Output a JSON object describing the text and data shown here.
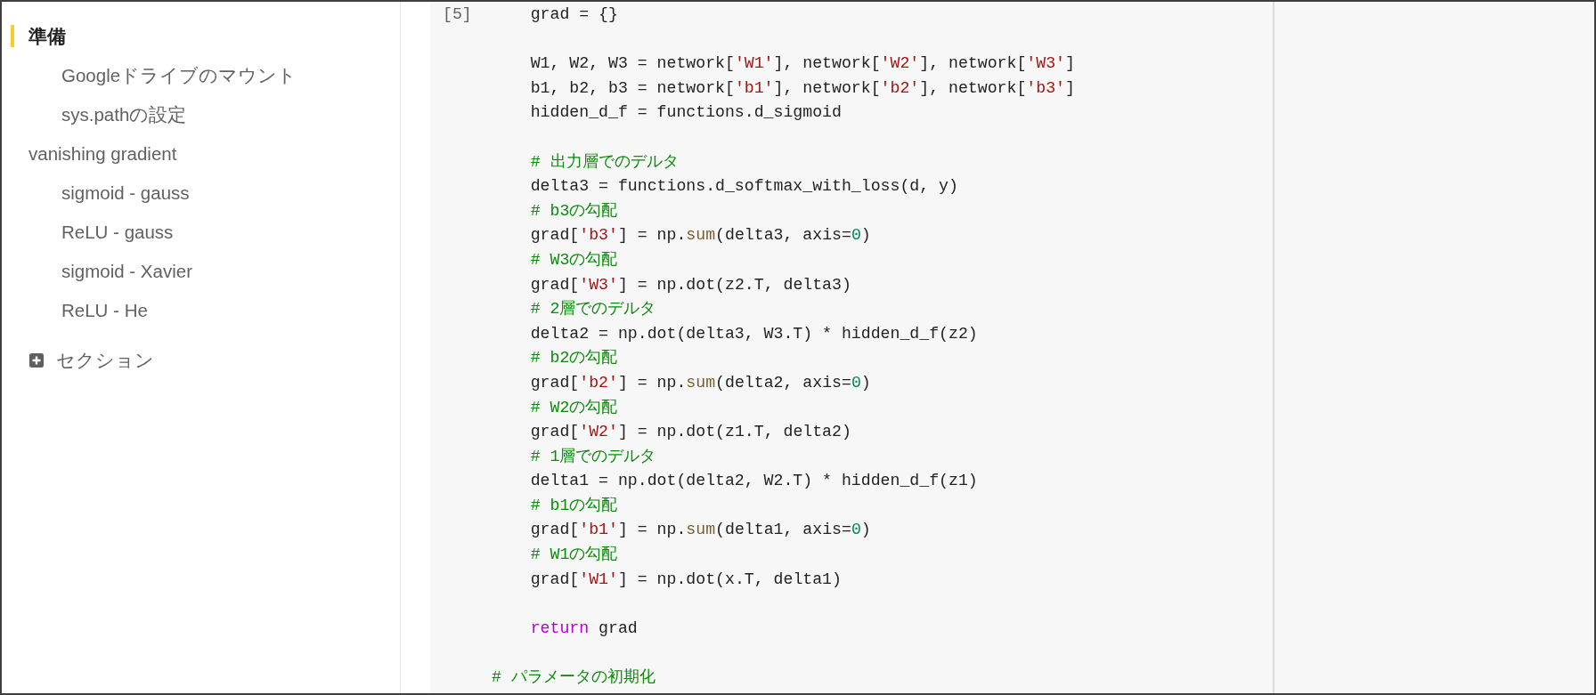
{
  "sidebar": {
    "items": [
      {
        "label": "準備",
        "selected": true,
        "children": [
          {
            "label": "Googleドライブのマウント",
            "selected": false
          },
          {
            "label": "sys.pathの設定",
            "selected": false
          }
        ]
      },
      {
        "label": "vanishing gradient",
        "selected": false,
        "children": [
          {
            "label": "sigmoid - gauss",
            "selected": false
          },
          {
            "label": "ReLU - gauss",
            "selected": false
          },
          {
            "label": "sigmoid - Xavier",
            "selected": false
          },
          {
            "label": "ReLU - He",
            "selected": false
          }
        ]
      }
    ],
    "add_section": {
      "label": "セクション"
    }
  },
  "code_cell": {
    "execution_count": "[5]",
    "blocks": [
      [
        [
          {
            "kind": "plain",
            "text": "    grad = {}"
          }
        ]
      ],
      [
        [
          {
            "kind": "plain",
            "text": "    W1, W2, W3 = network["
          },
          {
            "kind": "string",
            "text": "'W1'"
          },
          {
            "kind": "plain",
            "text": "], network["
          },
          {
            "kind": "string",
            "text": "'W2'"
          },
          {
            "kind": "plain",
            "text": "], network["
          },
          {
            "kind": "string",
            "text": "'W3'"
          },
          {
            "kind": "plain",
            "text": "]"
          }
        ],
        [
          {
            "kind": "plain",
            "text": "    b1, b2, b3 = network["
          },
          {
            "kind": "string",
            "text": "'b1'"
          },
          {
            "kind": "plain",
            "text": "], network["
          },
          {
            "kind": "string",
            "text": "'b2'"
          },
          {
            "kind": "plain",
            "text": "], network["
          },
          {
            "kind": "string",
            "text": "'b3'"
          },
          {
            "kind": "plain",
            "text": "]"
          }
        ],
        [
          {
            "kind": "plain",
            "text": "    hidden_d_f = functions.d_sigmoid"
          }
        ]
      ],
      [
        [
          {
            "kind": "comment",
            "text": "    # 出力層でのデルタ"
          }
        ],
        [
          {
            "kind": "plain",
            "text": "    delta3 = functions.d_softmax_with_loss(d, y)"
          }
        ],
        [
          {
            "kind": "comment",
            "text": "    # b3の勾配"
          }
        ],
        [
          {
            "kind": "plain",
            "text": "    grad["
          },
          {
            "kind": "string",
            "text": "'b3'"
          },
          {
            "kind": "plain",
            "text": "] = np."
          },
          {
            "kind": "function",
            "text": "sum"
          },
          {
            "kind": "plain",
            "text": "(delta3, axis="
          },
          {
            "kind": "number",
            "text": "0"
          },
          {
            "kind": "plain",
            "text": ")"
          }
        ],
        [
          {
            "kind": "comment",
            "text": "    # W3の勾配"
          }
        ],
        [
          {
            "kind": "plain",
            "text": "    grad["
          },
          {
            "kind": "string",
            "text": "'W3'"
          },
          {
            "kind": "plain",
            "text": "] = np.dot(z2.T, delta3)"
          }
        ],
        [
          {
            "kind": "comment",
            "text": "    # 2層でのデルタ"
          }
        ],
        [
          {
            "kind": "plain",
            "text": "    delta2 = np.dot(delta3, W3.T) * hidden_d_f(z2)"
          }
        ],
        [
          {
            "kind": "comment",
            "text": "    # b2の勾配"
          }
        ],
        [
          {
            "kind": "plain",
            "text": "    grad["
          },
          {
            "kind": "string",
            "text": "'b2'"
          },
          {
            "kind": "plain",
            "text": "] = np."
          },
          {
            "kind": "function",
            "text": "sum"
          },
          {
            "kind": "plain",
            "text": "(delta2, axis="
          },
          {
            "kind": "number",
            "text": "0"
          },
          {
            "kind": "plain",
            "text": ")"
          }
        ],
        [
          {
            "kind": "comment",
            "text": "    # W2の勾配"
          }
        ],
        [
          {
            "kind": "plain",
            "text": "    grad["
          },
          {
            "kind": "string",
            "text": "'W2'"
          },
          {
            "kind": "plain",
            "text": "] = np.dot(z1.T, delta2)"
          }
        ],
        [
          {
            "kind": "comment",
            "text": "    # 1層でのデルタ"
          }
        ],
        [
          {
            "kind": "plain",
            "text": "    delta1 = np.dot(delta2, W2.T) * hidden_d_f(z1)"
          }
        ],
        [
          {
            "kind": "comment",
            "text": "    # b1の勾配"
          }
        ],
        [
          {
            "kind": "plain",
            "text": "    grad["
          },
          {
            "kind": "string",
            "text": "'b1'"
          },
          {
            "kind": "plain",
            "text": "] = np."
          },
          {
            "kind": "function",
            "text": "sum"
          },
          {
            "kind": "plain",
            "text": "(delta1, axis="
          },
          {
            "kind": "number",
            "text": "0"
          },
          {
            "kind": "plain",
            "text": ")"
          }
        ],
        [
          {
            "kind": "comment",
            "text": "    # W1の勾配"
          }
        ],
        [
          {
            "kind": "plain",
            "text": "    grad["
          },
          {
            "kind": "string",
            "text": "'W1'"
          },
          {
            "kind": "plain",
            "text": "] = np.dot(x.T, delta1)"
          }
        ]
      ],
      [
        [
          {
            "kind": "keyword",
            "text": "    return"
          },
          {
            "kind": "plain",
            "text": " grad"
          }
        ]
      ],
      [
        [
          {
            "kind": "comment",
            "text": "# パラメータの初期化"
          }
        ]
      ]
    ]
  }
}
